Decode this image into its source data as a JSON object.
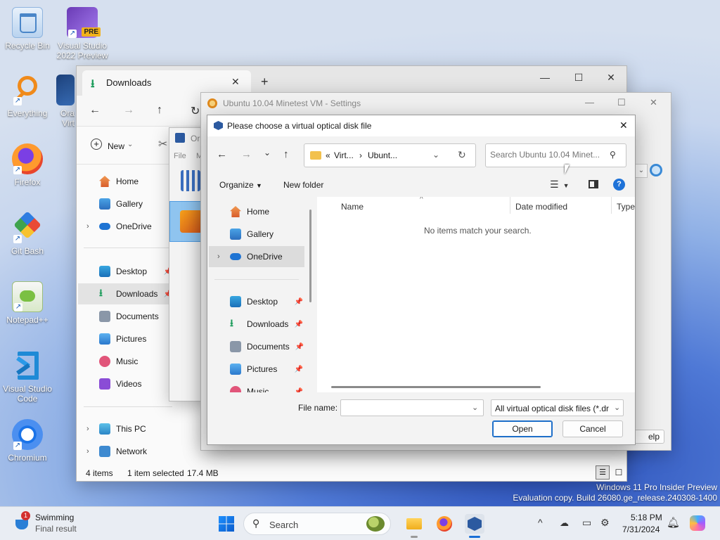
{
  "desktop": {
    "icons": [
      {
        "label": "Recycle Bin"
      },
      {
        "label": "Visual Studio 2022 Preview"
      },
      {
        "label": "Everything"
      },
      {
        "label": "Ora Virt"
      },
      {
        "label": "Firefox"
      },
      {
        "label": "Git Bash"
      },
      {
        "label": "Notepad++"
      },
      {
        "label": "Visual Studio Code"
      },
      {
        "label": "Chromium"
      }
    ],
    "vs_badge": "PRE",
    "watermark_line1": "Windows 11 Pro Insider Preview",
    "watermark_line2": "Evaluation copy. Build 26080.ge_release.240308-1400"
  },
  "explorer": {
    "tab_title": "Downloads",
    "new_label": "New",
    "nav": {
      "home": "Home",
      "gallery": "Gallery",
      "onedrive": "OneDrive",
      "desktop": "Desktop",
      "downloads": "Downloads",
      "documents": "Documents",
      "pictures": "Pictures",
      "music": "Music",
      "videos": "Videos",
      "thispc": "This PC",
      "network": "Network"
    },
    "status": {
      "items": "4 items",
      "selected": "1 item selected",
      "size": "17.4 MB"
    }
  },
  "oracle_window": {
    "title": "Or",
    "menu_file": "File",
    "menu_m": "M"
  },
  "settings_window": {
    "title": "Ubuntu 10.04 Minetest VM - Settings",
    "help_fragment": "elp"
  },
  "dialog": {
    "title": "Please choose a virtual optical disk file",
    "breadcrumb": {
      "prefix": "«",
      "part1": "Virt...",
      "sep": "›",
      "part2": "Ubunt..."
    },
    "search_placeholder": "Search Ubuntu 10.04 Minet...",
    "organize": "Organize",
    "new_folder": "New folder",
    "nav": {
      "home": "Home",
      "gallery": "Gallery",
      "onedrive": "OneDrive",
      "desktop": "Desktop",
      "downloads": "Downloads",
      "documents": "Documents",
      "pictures": "Pictures",
      "music": "Music"
    },
    "columns": {
      "name": "Name",
      "date": "Date modified",
      "type": "Type"
    },
    "empty_message": "No items match your search.",
    "file_name_label": "File name:",
    "file_name_value": "",
    "file_type": "All virtual optical disk files (*.dr",
    "open_label": "Open",
    "cancel_label": "Cancel"
  },
  "taskbar": {
    "weather_title": "Swimming",
    "weather_sub": "Final result",
    "weather_badge": "1",
    "search_label": "Search",
    "time": "5:18 PM",
    "date": "7/31/2024"
  }
}
